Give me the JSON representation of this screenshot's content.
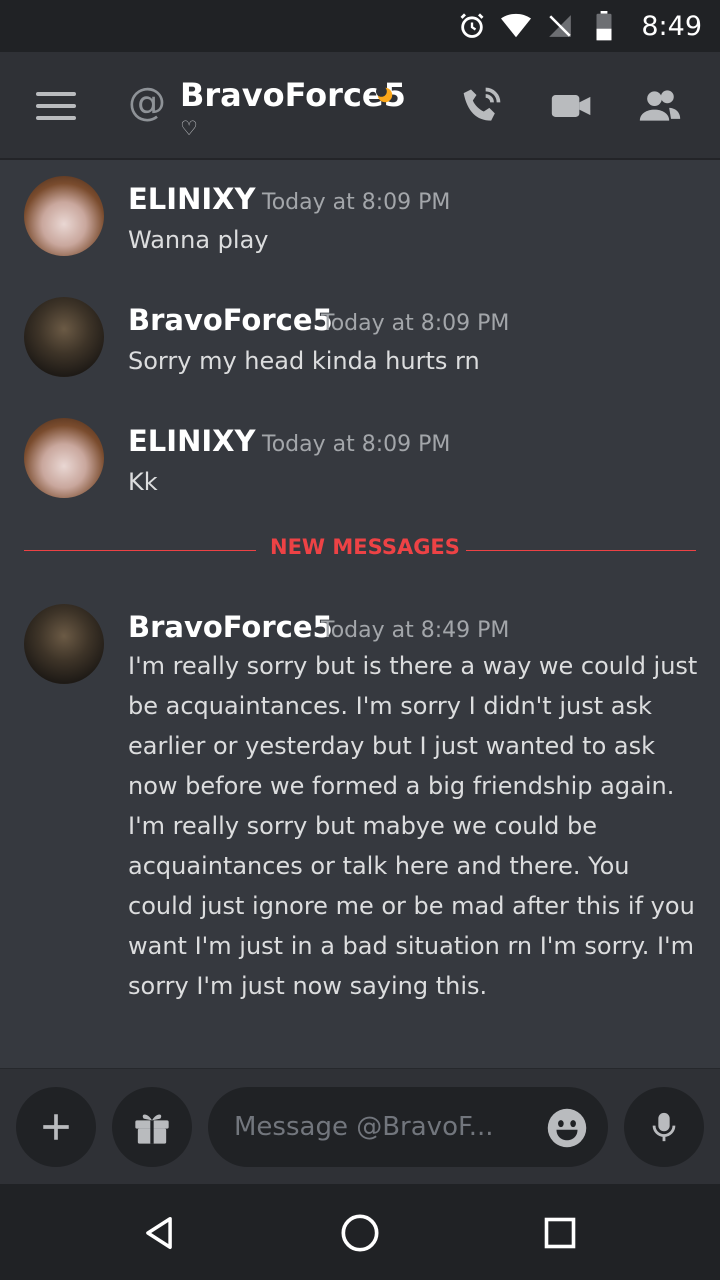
{
  "status_bar": {
    "time": "8:49"
  },
  "header": {
    "name": "BravoForce5",
    "custom_status": "♡"
  },
  "messages": [
    {
      "author": "ELINIXY",
      "time": "Today at 8:09 PM",
      "text": "Wanna play"
    },
    {
      "author": "BravoForce5",
      "time": "Today at 8:09 PM",
      "text": "Sorry my head kinda hurts rn"
    },
    {
      "author": "ELINIXY",
      "time": "Today at 8:09 PM",
      "text": "Kk"
    },
    {
      "author": "BravoForce5",
      "time": "Today at 8:49 PM",
      "text": "I'm really sorry but is there a way we could just be acquaintances. I'm sorry I didn't just ask earlier or yesterday but I just wanted to ask now before we formed a big friendship again. I'm really sorry but mabye we could be acquaintances or talk here and there. You could just ignore me or be mad after this if you want I'm just in a bad situation rn I'm sorry. I'm sorry I'm just now saying this."
    }
  ],
  "divider": {
    "label": "NEW MESSAGES"
  },
  "composer": {
    "placeholder": "Message @BravoF..."
  },
  "colors": {
    "accent_red": "#ed4245",
    "idle_yellow": "#faa61a",
    "background": "#36393f"
  }
}
